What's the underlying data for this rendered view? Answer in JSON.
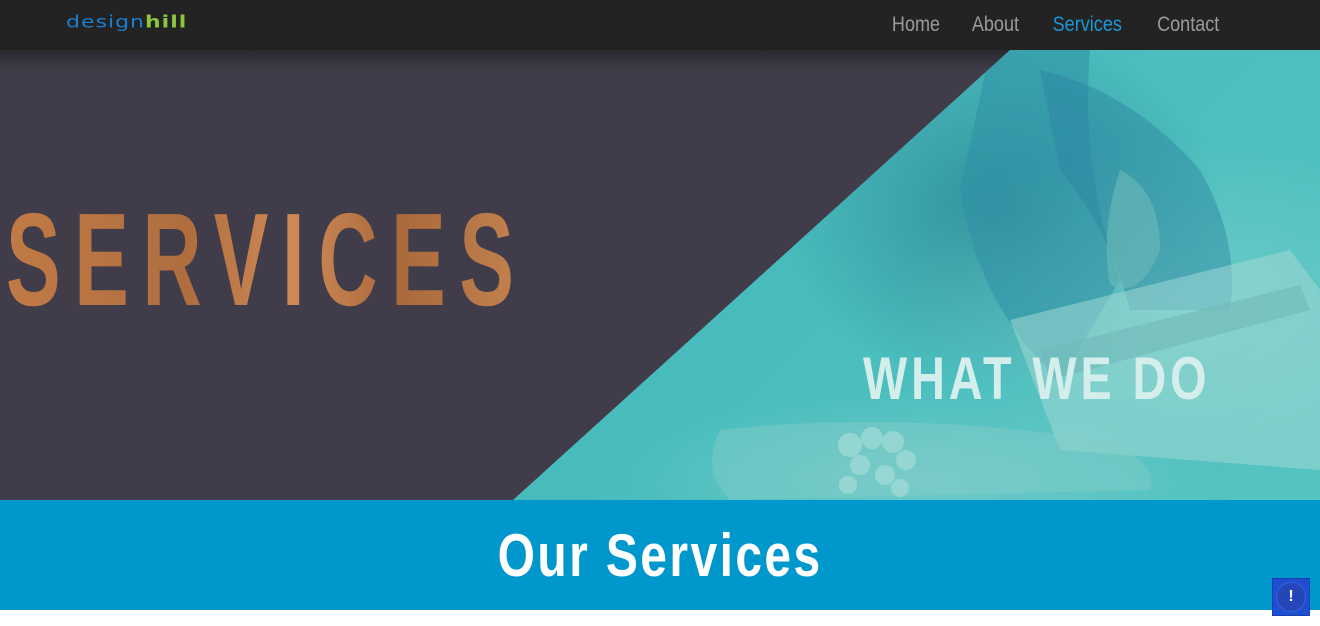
{
  "header": {
    "logo": {
      "part1": "design",
      "part2": "hill"
    },
    "nav": [
      {
        "label": "Home",
        "active": false
      },
      {
        "label": "About",
        "active": false
      },
      {
        "label": "Services",
        "active": true
      },
      {
        "label": "Contact",
        "active": false
      }
    ]
  },
  "hero": {
    "title": "SERVICES",
    "subtitle": "WHAT WE DO"
  },
  "band": {
    "title": "Our Services"
  },
  "widget": {
    "icon": "exclamation-icon",
    "glyph": "!"
  },
  "colors": {
    "nav_bg": "#232323",
    "nav_active": "#1899d6",
    "hero_dark": "#403c49",
    "hero_teal": "#43b9bb",
    "band_blue": "#0097cc",
    "logo_blue": "#1a7fd0",
    "logo_green": "#8cc63f"
  }
}
